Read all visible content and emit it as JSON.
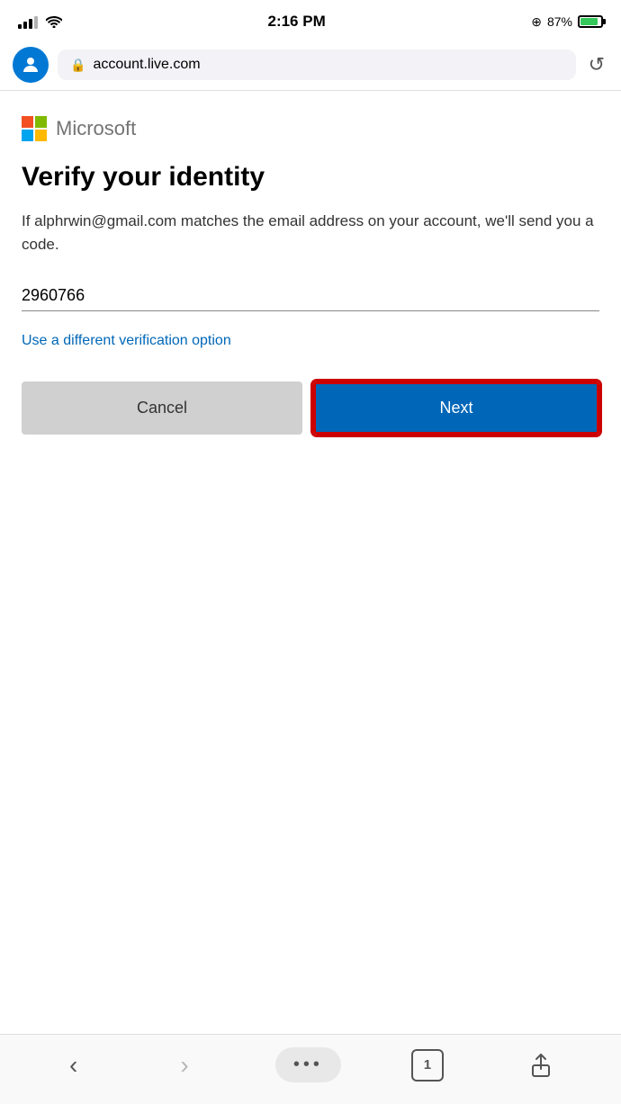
{
  "status_bar": {
    "time": "2:16 PM",
    "battery_percent": "87%",
    "battery_charging": true
  },
  "browser": {
    "url": "account.live.com",
    "reload_label": "↺"
  },
  "microsoft": {
    "brand_name": "Microsoft"
  },
  "page": {
    "title": "Verify your identity",
    "description": "If alphrwin@gmail.com matches the email address on your account, we'll send you a code.",
    "input_value": "2960766",
    "input_placeholder": "",
    "verify_link_text": "Use a different verification option",
    "cancel_label": "Cancel",
    "next_label": "Next"
  },
  "bottom_nav": {
    "back_label": "‹",
    "forward_label": "›",
    "dots_label": "•••",
    "tabs_count": "1",
    "share_label": "↑"
  }
}
